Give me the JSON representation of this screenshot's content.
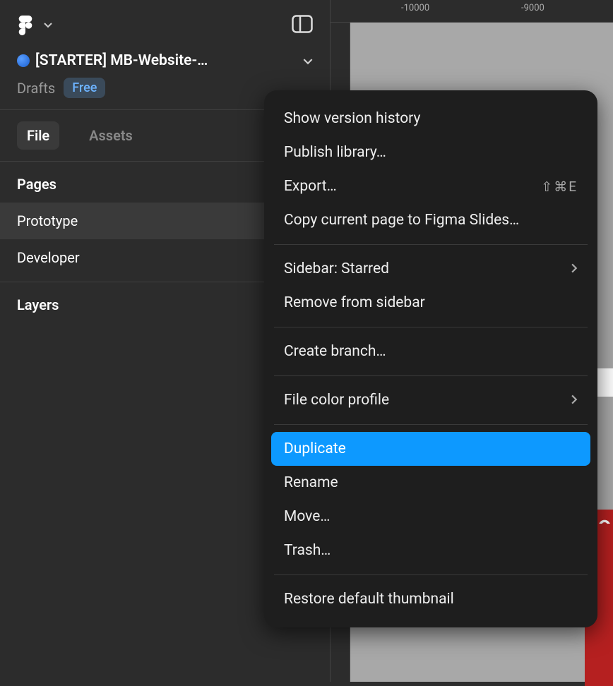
{
  "file": {
    "name": "[STARTER] MB-Website-…",
    "location": "Drafts",
    "badge": "Free"
  },
  "tabs": {
    "file": "File",
    "assets": "Assets"
  },
  "sections": {
    "pages": "Pages",
    "layers": "Layers"
  },
  "pages": {
    "prototype": "Prototype",
    "developer": "Developer"
  },
  "ruler": {
    "tick1": "-10000",
    "tick2": "-9000"
  },
  "canvas_letter": "O",
  "menu": {
    "show_version_history": "Show version history",
    "publish_library": "Publish library…",
    "export": "Export…",
    "export_shortcut": "⇧⌘E",
    "copy_to_slides": "Copy current page to Figma Slides…",
    "sidebar_starred": "Sidebar: Starred",
    "remove_from_sidebar": "Remove from sidebar",
    "create_branch": "Create branch…",
    "file_color_profile": "File color profile",
    "duplicate": "Duplicate",
    "rename": "Rename",
    "move": "Move…",
    "trash": "Trash…",
    "restore_thumbnail": "Restore default thumbnail"
  }
}
